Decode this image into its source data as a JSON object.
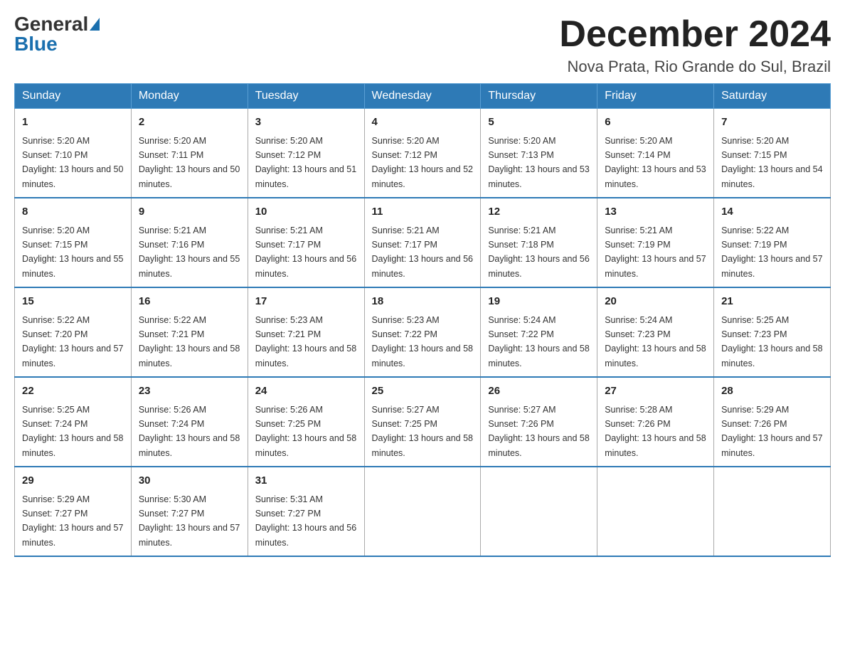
{
  "logo": {
    "general": "General",
    "blue": "Blue"
  },
  "title": "December 2024",
  "location": "Nova Prata, Rio Grande do Sul, Brazil",
  "headers": [
    "Sunday",
    "Monday",
    "Tuesday",
    "Wednesday",
    "Thursday",
    "Friday",
    "Saturday"
  ],
  "weeks": [
    [
      {
        "day": "1",
        "sunrise": "5:20 AM",
        "sunset": "7:10 PM",
        "daylight": "13 hours and 50 minutes."
      },
      {
        "day": "2",
        "sunrise": "5:20 AM",
        "sunset": "7:11 PM",
        "daylight": "13 hours and 50 minutes."
      },
      {
        "day": "3",
        "sunrise": "5:20 AM",
        "sunset": "7:12 PM",
        "daylight": "13 hours and 51 minutes."
      },
      {
        "day": "4",
        "sunrise": "5:20 AM",
        "sunset": "7:12 PM",
        "daylight": "13 hours and 52 minutes."
      },
      {
        "day": "5",
        "sunrise": "5:20 AM",
        "sunset": "7:13 PM",
        "daylight": "13 hours and 53 minutes."
      },
      {
        "day": "6",
        "sunrise": "5:20 AM",
        "sunset": "7:14 PM",
        "daylight": "13 hours and 53 minutes."
      },
      {
        "day": "7",
        "sunrise": "5:20 AM",
        "sunset": "7:15 PM",
        "daylight": "13 hours and 54 minutes."
      }
    ],
    [
      {
        "day": "8",
        "sunrise": "5:20 AM",
        "sunset": "7:15 PM",
        "daylight": "13 hours and 55 minutes."
      },
      {
        "day": "9",
        "sunrise": "5:21 AM",
        "sunset": "7:16 PM",
        "daylight": "13 hours and 55 minutes."
      },
      {
        "day": "10",
        "sunrise": "5:21 AM",
        "sunset": "7:17 PM",
        "daylight": "13 hours and 56 minutes."
      },
      {
        "day": "11",
        "sunrise": "5:21 AM",
        "sunset": "7:17 PM",
        "daylight": "13 hours and 56 minutes."
      },
      {
        "day": "12",
        "sunrise": "5:21 AM",
        "sunset": "7:18 PM",
        "daylight": "13 hours and 56 minutes."
      },
      {
        "day": "13",
        "sunrise": "5:21 AM",
        "sunset": "7:19 PM",
        "daylight": "13 hours and 57 minutes."
      },
      {
        "day": "14",
        "sunrise": "5:22 AM",
        "sunset": "7:19 PM",
        "daylight": "13 hours and 57 minutes."
      }
    ],
    [
      {
        "day": "15",
        "sunrise": "5:22 AM",
        "sunset": "7:20 PM",
        "daylight": "13 hours and 57 minutes."
      },
      {
        "day": "16",
        "sunrise": "5:22 AM",
        "sunset": "7:21 PM",
        "daylight": "13 hours and 58 minutes."
      },
      {
        "day": "17",
        "sunrise": "5:23 AM",
        "sunset": "7:21 PM",
        "daylight": "13 hours and 58 minutes."
      },
      {
        "day": "18",
        "sunrise": "5:23 AM",
        "sunset": "7:22 PM",
        "daylight": "13 hours and 58 minutes."
      },
      {
        "day": "19",
        "sunrise": "5:24 AM",
        "sunset": "7:22 PM",
        "daylight": "13 hours and 58 minutes."
      },
      {
        "day": "20",
        "sunrise": "5:24 AM",
        "sunset": "7:23 PM",
        "daylight": "13 hours and 58 minutes."
      },
      {
        "day": "21",
        "sunrise": "5:25 AM",
        "sunset": "7:23 PM",
        "daylight": "13 hours and 58 minutes."
      }
    ],
    [
      {
        "day": "22",
        "sunrise": "5:25 AM",
        "sunset": "7:24 PM",
        "daylight": "13 hours and 58 minutes."
      },
      {
        "day": "23",
        "sunrise": "5:26 AM",
        "sunset": "7:24 PM",
        "daylight": "13 hours and 58 minutes."
      },
      {
        "day": "24",
        "sunrise": "5:26 AM",
        "sunset": "7:25 PM",
        "daylight": "13 hours and 58 minutes."
      },
      {
        "day": "25",
        "sunrise": "5:27 AM",
        "sunset": "7:25 PM",
        "daylight": "13 hours and 58 minutes."
      },
      {
        "day": "26",
        "sunrise": "5:27 AM",
        "sunset": "7:26 PM",
        "daylight": "13 hours and 58 minutes."
      },
      {
        "day": "27",
        "sunrise": "5:28 AM",
        "sunset": "7:26 PM",
        "daylight": "13 hours and 58 minutes."
      },
      {
        "day": "28",
        "sunrise": "5:29 AM",
        "sunset": "7:26 PM",
        "daylight": "13 hours and 57 minutes."
      }
    ],
    [
      {
        "day": "29",
        "sunrise": "5:29 AM",
        "sunset": "7:27 PM",
        "daylight": "13 hours and 57 minutes."
      },
      {
        "day": "30",
        "sunrise": "5:30 AM",
        "sunset": "7:27 PM",
        "daylight": "13 hours and 57 minutes."
      },
      {
        "day": "31",
        "sunrise": "5:31 AM",
        "sunset": "7:27 PM",
        "daylight": "13 hours and 56 minutes."
      },
      null,
      null,
      null,
      null
    ]
  ]
}
